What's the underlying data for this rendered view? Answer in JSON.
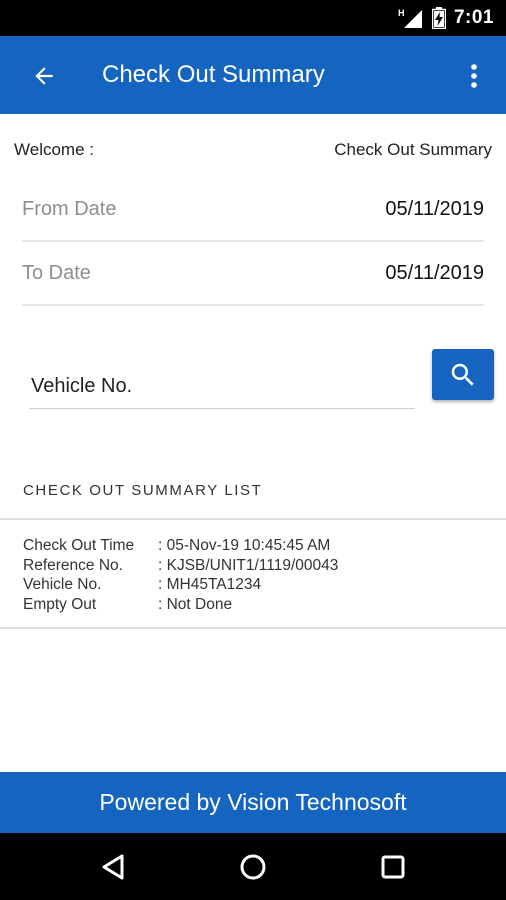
{
  "status_bar": {
    "time": "7:01",
    "network_indicator": "H",
    "icons": [
      "signal-icon",
      "battery-charging-icon"
    ]
  },
  "app_bar": {
    "title": "Check Out Summary",
    "back_icon": "arrow-back-icon",
    "menu_icon": "more-vertical-icon"
  },
  "welcome": {
    "label": "Welcome :",
    "screen_name": "Check Out Summary"
  },
  "filters": {
    "from_date_label": "From Date",
    "from_date_value": "05/11/2019",
    "to_date_label": "To Date",
    "to_date_value": "05/11/2019",
    "vehicle_placeholder": "Vehicle No.",
    "vehicle_value": "",
    "search_icon": "search-icon"
  },
  "list": {
    "header": "CHECK OUT SUMMARY LIST",
    "items": [
      {
        "check_out_time_label": "Check Out Time",
        "check_out_time": ": 05-Nov-19 10:45:45 AM",
        "reference_no_label": "Reference No.",
        "reference_no": ": KJSB/UNIT1/1119/00043",
        "vehicle_no_label": "Vehicle No.",
        "vehicle_no": ": MH45TA1234",
        "empty_out_label": "Empty Out",
        "empty_out": ": Not Done"
      }
    ]
  },
  "footer": {
    "text": "Powered by Vision Technosoft"
  },
  "nav_bar": {
    "icons": [
      "nav-back-icon",
      "nav-home-icon",
      "nav-recents-icon"
    ]
  },
  "colors": {
    "primary": "#1565c0",
    "status_bar": "#000000",
    "divider": "#dedede",
    "muted_text": "#8e8e8e"
  }
}
